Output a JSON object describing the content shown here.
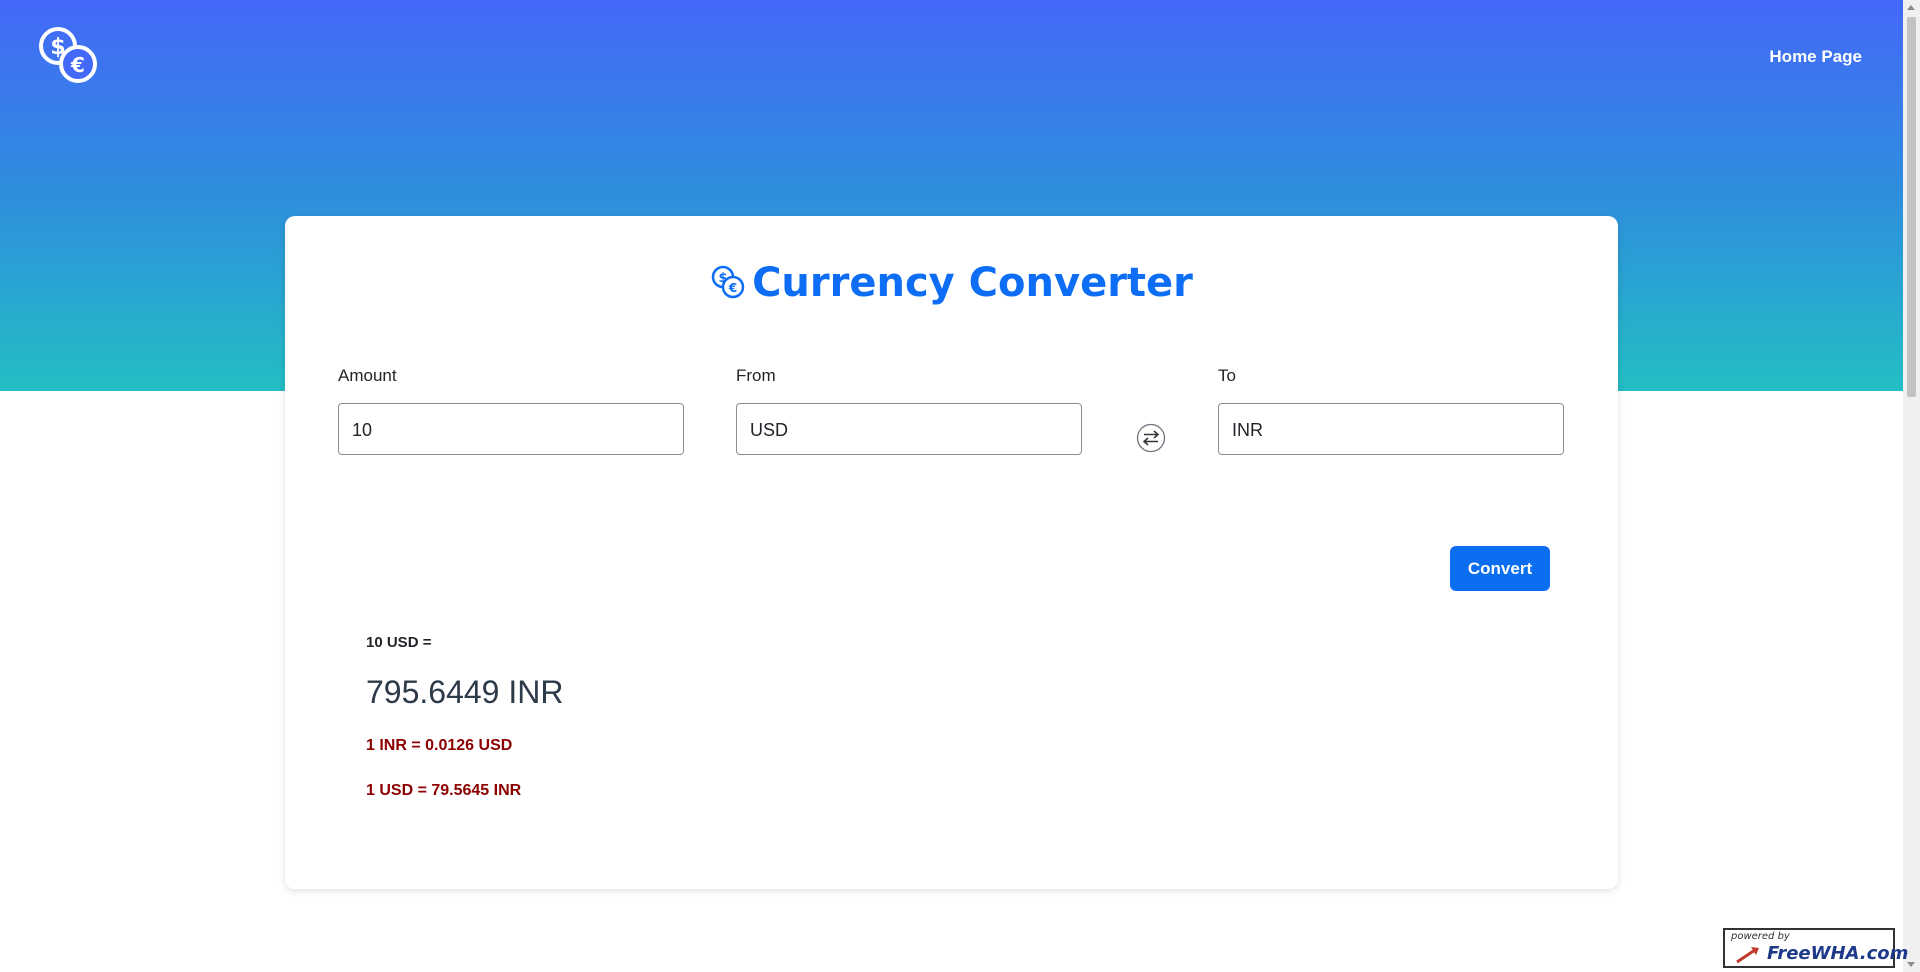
{
  "nav": {
    "home_label": "Home Page"
  },
  "card": {
    "title": "Currency Converter",
    "amount": {
      "label": "Amount",
      "value": "10"
    },
    "from": {
      "label": "From",
      "value": "USD"
    },
    "to": {
      "label": "To",
      "value": "INR"
    },
    "convert_label": "Convert"
  },
  "result": {
    "base": "10 USD =",
    "converted": "795.6449 INR",
    "rate_inverse": "1 INR = 0.0126 USD",
    "rate_forward": "1 USD = 79.5645 INR"
  },
  "footer": {
    "powered_by": "powered by",
    "brand": "FreeWHA.com"
  },
  "icons": {
    "logo": "coins-dollar-euro-icon",
    "swap": "swap-arrows-icon"
  },
  "colors": {
    "gradient_top": "#4468f8",
    "gradient_bottom": "#23bec4",
    "accent": "#0b6df0",
    "rate_text": "#8c0000"
  }
}
